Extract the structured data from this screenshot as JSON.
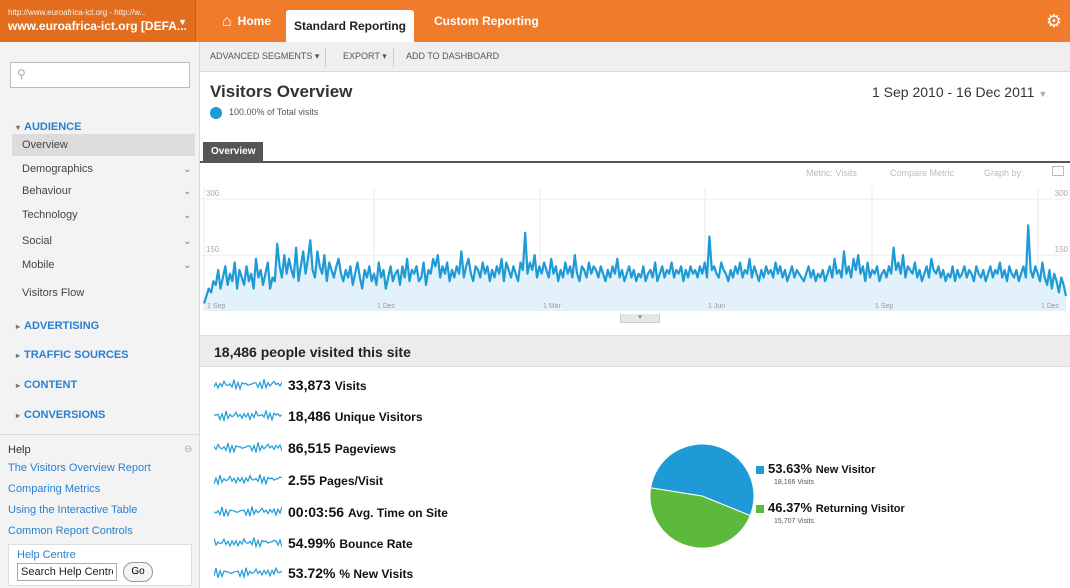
{
  "account": {
    "line1": "http://www.euroafrica-ict.org - http://w...",
    "line2": "www.euroafrica-ict.org [DEFA..."
  },
  "topnav": {
    "home": "Home",
    "standard": "Standard Reporting",
    "custom": "Custom Reporting"
  },
  "sidebar": {
    "sections": {
      "audience": "AUDIENCE",
      "advertising": "ADVERTISING",
      "traffic": "TRAFFIC SOURCES",
      "content": "CONTENT",
      "conversions": "CONVERSIONS"
    },
    "audience_items": [
      "Overview",
      "Demographics",
      "Behaviour",
      "Technology",
      "Social",
      "Mobile",
      "Visitors Flow"
    ],
    "help": {
      "title": "Help",
      "links": [
        "The Visitors Overview Report",
        "Comparing Metrics",
        "Using the Interactive Table",
        "Common Report Controls"
      ],
      "centre": "Help Centre",
      "search_value": "Search Help Centre",
      "go": "Go"
    }
  },
  "toolbar": {
    "segments": "ADVANCED SEGMENTS",
    "export": "EXPORT",
    "dashboard": "ADD TO DASHBOARD"
  },
  "report": {
    "title": "Visitors Overview",
    "segment": "100.00% of Total visits",
    "date_range": "1 Sep 2010 - 16 Dec 2011",
    "tab": "Overview",
    "chart_options": {
      "metric": "Metric: Visits",
      "compare": "Compare Metric",
      "graph_by": "Graph by:"
    }
  },
  "chart_data": {
    "type": "line",
    "series": [
      {
        "values": [
          20,
          40,
          60,
          50,
          80,
          70,
          110,
          60,
          90,
          120,
          70,
          100,
          80,
          130,
          60,
          110,
          90,
          70,
          120,
          80,
          100,
          60,
          140,
          90,
          110,
          70,
          100,
          130,
          60,
          90,
          80,
          180,
          120,
          90,
          150,
          100,
          140,
          110,
          90,
          170,
          80,
          120,
          160,
          100,
          140,
          190,
          110,
          90,
          160,
          120,
          100,
          150,
          80,
          130,
          110,
          90,
          120,
          140,
          100,
          80,
          110,
          90,
          120,
          70,
          100,
          130,
          90,
          60,
          110,
          90,
          120,
          80,
          100,
          70,
          130,
          90,
          110,
          60,
          90,
          120,
          80,
          100,
          110,
          70,
          120,
          90,
          140,
          80,
          110,
          100,
          120,
          80,
          90,
          130,
          70,
          110,
          100,
          140,
          120,
          150,
          90,
          120,
          100,
          130,
          80,
          110,
          90,
          120,
          100,
          160,
          90,
          120,
          140,
          100,
          80,
          120,
          110,
          90,
          130,
          100,
          120,
          80,
          110,
          90,
          120,
          100,
          140,
          80,
          130,
          110,
          90,
          120,
          100,
          80,
          130,
          110,
          210,
          100,
          130,
          110,
          150,
          90,
          120,
          100,
          130,
          110,
          90,
          140,
          100,
          120,
          80,
          110,
          90,
          130,
          100,
          120,
          90,
          150,
          100,
          80,
          120,
          110,
          90,
          130,
          100,
          120,
          110,
          90,
          120,
          100,
          80,
          110,
          90,
          120,
          100,
          140,
          90,
          110,
          80,
          100,
          120,
          90,
          110,
          80,
          100,
          90,
          120,
          80,
          100,
          110,
          90,
          130,
          80,
          100,
          120,
          90,
          110,
          100,
          130,
          90,
          110,
          100,
          120,
          80,
          110,
          90,
          120,
          100,
          110,
          90,
          120,
          100,
          130,
          90,
          200,
          110,
          120,
          100,
          90,
          130,
          110,
          100,
          80,
          110,
          90,
          120,
          100,
          130,
          90,
          110,
          100,
          140,
          90,
          120,
          100,
          80,
          110,
          90,
          120,
          100,
          110,
          90,
          130,
          100,
          120,
          90,
          110,
          80,
          100,
          120,
          90,
          110,
          100,
          90,
          80,
          100,
          120,
          90,
          110,
          80,
          100,
          90,
          110,
          80,
          100,
          120,
          90,
          140,
          100,
          110,
          90,
          160,
          100,
          120,
          90,
          140,
          110,
          150,
          100,
          120,
          80,
          130,
          90,
          110,
          100,
          120,
          80,
          100,
          110,
          90,
          120,
          100,
          170,
          110,
          130,
          100,
          150,
          90,
          120,
          110,
          100,
          130,
          90,
          110,
          80,
          100,
          120,
          90,
          140,
          110,
          100,
          120,
          90,
          110,
          80,
          100,
          90,
          120,
          80,
          110,
          90,
          100,
          120,
          90,
          110,
          100,
          80,
          120,
          100,
          90,
          110,
          80,
          100,
          120,
          90,
          110,
          100,
          130,
          90,
          110,
          80,
          120,
          100,
          90,
          110,
          80,
          100,
          120,
          90,
          230,
          110,
          90,
          120,
          100,
          80,
          130,
          90,
          70,
          110,
          60,
          100,
          80,
          50,
          90,
          70,
          40
        ]
      }
    ],
    "ylim": [
      0,
      330
    ],
    "y_ticks": [
      "150",
      "300"
    ],
    "x_ticks": [
      "1 Sep",
      "1 Dec",
      "1 Mar",
      "1 Jun",
      "1 Sep",
      "1 Dec"
    ]
  },
  "summary": {
    "title": "18,486 people visited this site",
    "metrics": [
      {
        "value": "33,873",
        "label": "Visits"
      },
      {
        "value": "18,486",
        "label": "Unique Visitors"
      },
      {
        "value": "86,515",
        "label": "Pageviews"
      },
      {
        "value": "2.55",
        "label": "Pages/Visit"
      },
      {
        "value": "00:03:56",
        "label": "Avg. Time on Site"
      },
      {
        "value": "54.99%",
        "label": "Bounce Rate"
      },
      {
        "value": "53.72%",
        "label": "% New Visits"
      }
    ]
  },
  "visitor_pie": {
    "colors": {
      "new": "#1e9ad6",
      "returning": "#5cb93b"
    },
    "new": {
      "pct": "53.63%",
      "label": "New Visitor",
      "sub": "18,166 Visits",
      "share": 53.63
    },
    "returning": {
      "pct": "46.37%",
      "label": "Returning Visitor",
      "sub": "15,707 Visits",
      "share": 46.37
    }
  }
}
